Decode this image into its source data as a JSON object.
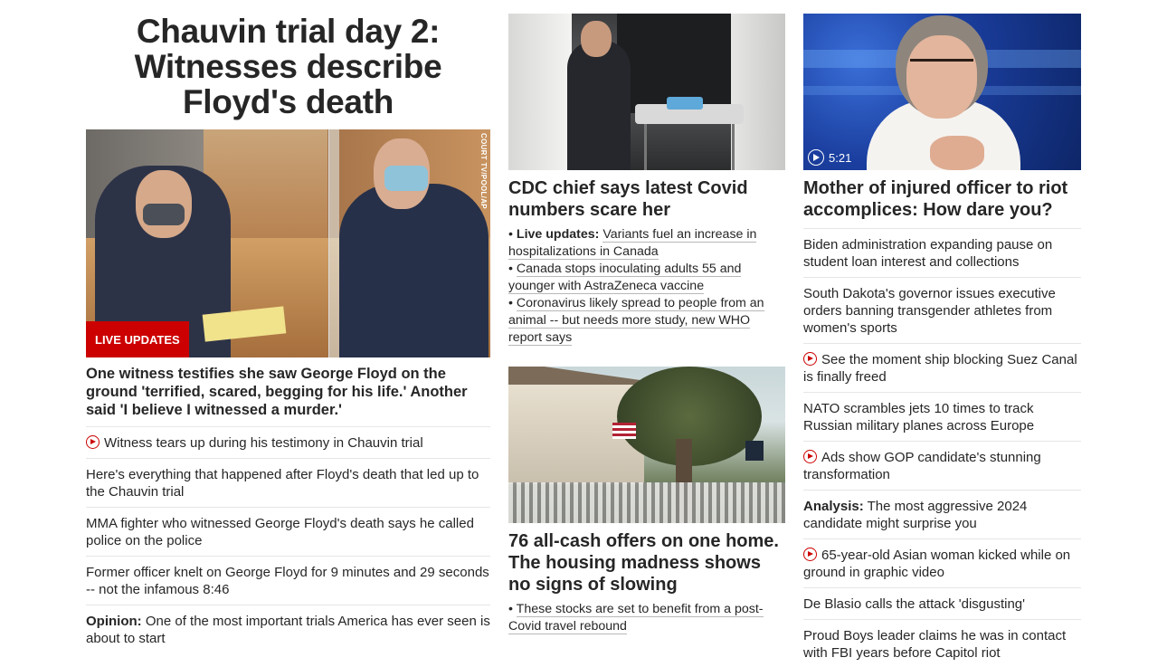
{
  "left": {
    "headline": "Chauvin trial day 2: Witnesses describe Floyd's death",
    "image_credit": "COURT TV/POOL/AP",
    "badge": "LIVE UPDATES",
    "lede": "One witness testifies she saw George Floyd on the ground 'terrified, scared, begging for his life.' Another said 'I believe I witnessed a murder.'",
    "items": [
      {
        "text": "Witness tears up during his testimony in Chauvin trial",
        "video": true
      },
      {
        "text": "Here's everything that happened after Floyd's death that led up to the Chauvin trial"
      },
      {
        "text": "MMA fighter who witnessed George Floyd's death says he called police on the police"
      },
      {
        "text": "Former officer knelt on George Floyd for 9 minutes and 29 seconds -- not the infamous 8:46"
      },
      {
        "prefix": "Opinion:",
        "text": "One of the most important trials America has ever seen is about to start"
      }
    ]
  },
  "middle": {
    "covid": {
      "title": "CDC chief says latest Covid numbers scare her",
      "bullets": [
        {
          "prefix": "Live updates:",
          "text": "Variants fuel an increase in hospitalizations in Canada"
        },
        {
          "text": "Canada stops inoculating adults 55 and younger with AstraZeneca vaccine"
        },
        {
          "text": "Coronavirus likely spread to people from an animal -- but needs more study, new WHO report says"
        }
      ]
    },
    "housing": {
      "title": "76 all-cash offers on one home. The housing madness shows no signs of slowing",
      "bullets": [
        {
          "text": "These stocks are set to benefit from a post-Covid travel rebound"
        }
      ]
    }
  },
  "right": {
    "video_duration": "5:21",
    "title": "Mother of injured officer to riot accomplices: How dare you?",
    "items": [
      {
        "text": "Biden administration expanding pause on student loan interest and collections"
      },
      {
        "text": "South Dakota's governor issues executive orders banning transgender athletes from women's sports"
      },
      {
        "text": "See the moment ship blocking Suez Canal is finally freed",
        "video": true
      },
      {
        "text": "NATO scrambles jets 10 times to track Russian military planes across Europe"
      },
      {
        "text": "Ads show GOP candidate's stunning transformation",
        "video": true
      },
      {
        "prefix": "Analysis:",
        "text": "The most aggressive 2024 candidate might surprise you"
      },
      {
        "text": "65-year-old Asian woman kicked while on ground in graphic video",
        "video": true
      },
      {
        "text": "De Blasio calls the attack 'disgusting'"
      },
      {
        "text": "Proud Boys leader claims he was in contact with FBI years before Capitol riot"
      }
    ]
  },
  "colors": {
    "accent_red": "#cc0000",
    "text": "#262626",
    "divider": "#e6e6e6"
  }
}
